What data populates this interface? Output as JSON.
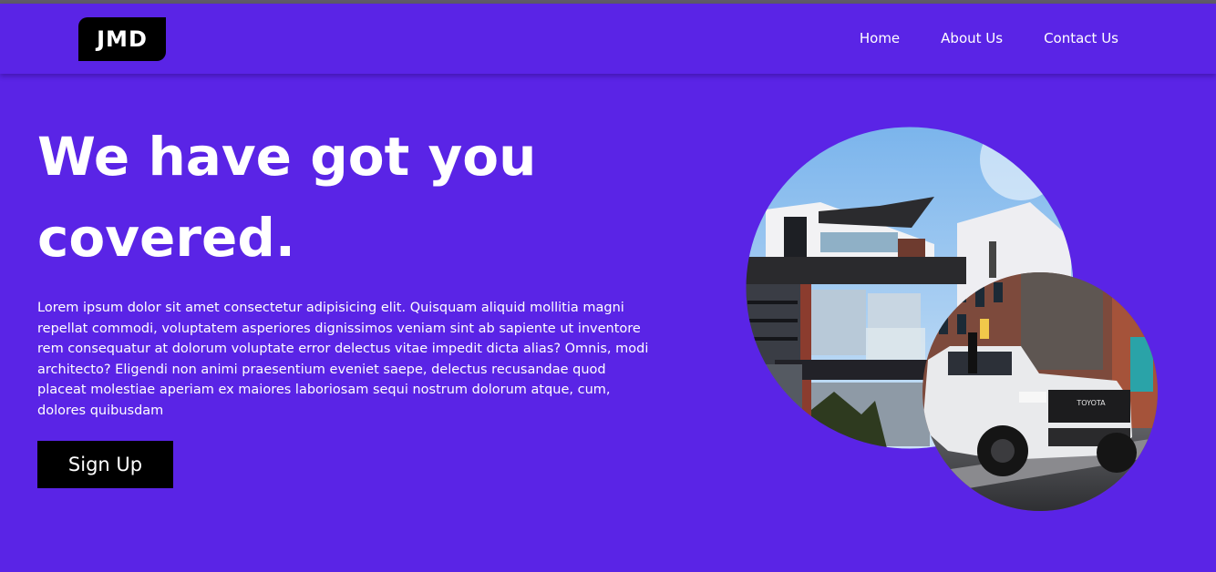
{
  "brand": {
    "logo_text": "JMD"
  },
  "nav": {
    "items": [
      "Home",
      "About Us",
      "Contact Us"
    ]
  },
  "hero": {
    "title": "We have got you covered.",
    "body": "Lorem ipsum dolor sit amet consectetur adipisicing elit. Quisquam aliquid mollitia magni repellat commodi, voluptatem asperiores dignissimos veniam sint ab sapiente ut inventore rem consequatur at dolorum voluptate error delectus vitae impedit dicta alias? Omnis, modi architecto? Eligendi non animi praesentium eveniet saepe, delectus recusandae quod placeat molestiae aperiam ex maiores laboriosam sequi nostrum dolorum atque, cum, dolores quibusdam",
    "cta_label": "Sign Up"
  },
  "images": [
    {
      "name": "house-photo",
      "subject": "modern-house"
    },
    {
      "name": "truck-photo",
      "subject": "white-pickup-truck",
      "badge_text": "TOYOTA"
    }
  ]
}
